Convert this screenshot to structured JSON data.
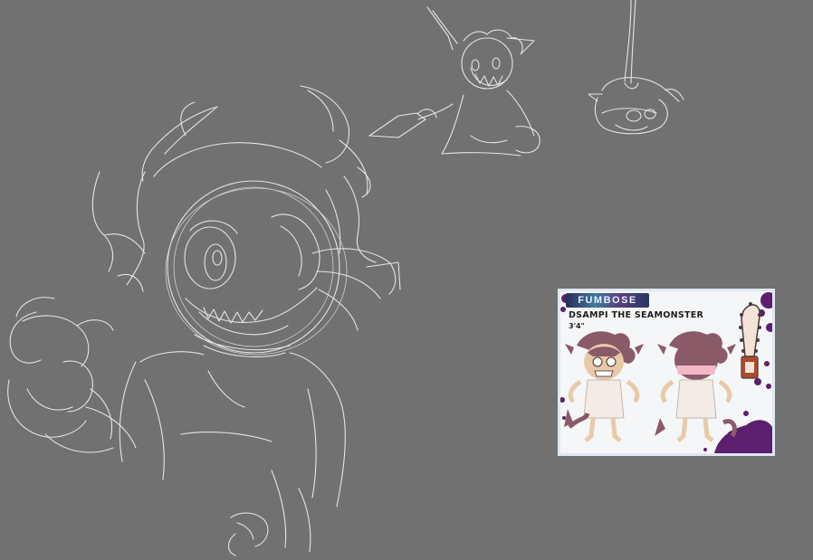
{
  "canvas": {
    "background": "#717171",
    "stroke_color": "#e4e4e4"
  },
  "reference_card": {
    "logo_text": "FUMBOSE",
    "character_name": "DSAMPI THE SEAMONSTER",
    "height": "3'4\"",
    "accent_color": "#5b1f6e",
    "skin_color": "#e9c9a8",
    "hair_color": "#8a5a68",
    "outfit_color": "#f3ece6",
    "weapon_color": "#b04a2c"
  },
  "icons": {
    "chainsaw": "chainsaw-icon"
  }
}
